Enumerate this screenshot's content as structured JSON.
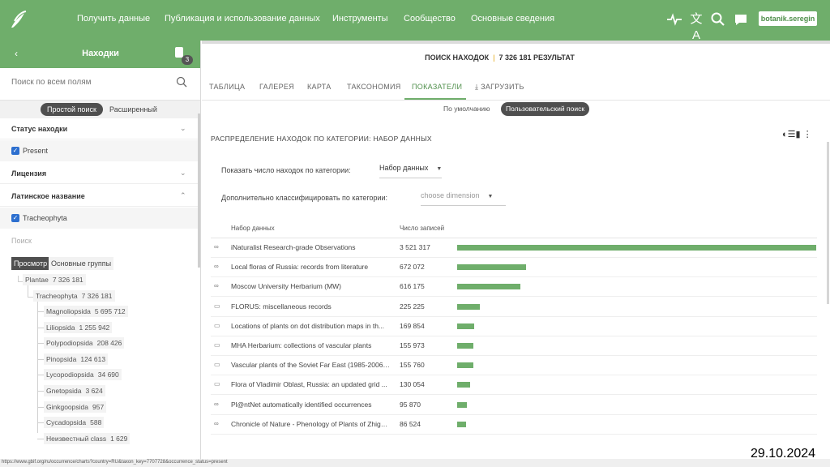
{
  "header": {
    "nav": [
      "Получить данные",
      "Публикация и использование данных",
      "Инструменты",
      "Сообщество",
      "Основные сведения"
    ],
    "user": "botanik.seregin"
  },
  "sidebar": {
    "back": "‹",
    "title": "Находки",
    "badge": "3",
    "search_placeholder": "Поиск по всем полям",
    "mode_simple": "Простой поиск",
    "mode_advanced": "Расширенный",
    "filters": {
      "status_label": "Статус находки",
      "status_value": "Present",
      "license_label": "Лицензия",
      "latin_label": "Латинское название",
      "latin_value": "Tracheophyta",
      "search_label": "Поиск"
    },
    "tree_tabs": {
      "view": "Просмотр",
      "groups": "Основные группы"
    },
    "tree": {
      "plantae": {
        "name": "Plantae",
        "count": "7 326 181"
      },
      "tracheophyta": {
        "name": "Tracheophyta",
        "count": "7 326 181"
      },
      "classes": [
        {
          "name": "Magnoliopsida",
          "count": "5 695 712"
        },
        {
          "name": "Liliopsida",
          "count": "1 255 942"
        },
        {
          "name": "Polypodiopsida",
          "count": "208 426"
        },
        {
          "name": "Pinopsida",
          "count": "124 613"
        },
        {
          "name": "Lycopodiopsida",
          "count": "34 690"
        },
        {
          "name": "Gnetopsida",
          "count": "3 624"
        },
        {
          "name": "Ginkgoopsida",
          "count": "957"
        },
        {
          "name": "Cycadopsida",
          "count": "588"
        },
        {
          "name": "Неизвестный class",
          "count": "1 629"
        }
      ]
    }
  },
  "main": {
    "results_label": "ПОИСК НАХОДОК",
    "results_count": "7 326 181 РЕЗУЛЬТАТ",
    "tabs": [
      "ТАБЛИЦА",
      "ГАЛЕРЕЯ",
      "КАРТА",
      "ТАКСОНОМИЯ",
      "ПОКАЗАТЕЛИ",
      "ЗАГРУЗИТЬ"
    ],
    "active_tab": "ПОКАЗАТЕЛИ",
    "sub_default": "По умолчанию",
    "sub_custom": "Пользовательский поиск",
    "card_title": "РАСПРЕДЕЛЕНИЕ НАХОДОК ПО КАТЕГОРИИ: НАБОР ДАННЫХ",
    "show_label": "Показать число находок по категории:",
    "show_value": "Набор данных",
    "extra_label": "Дополнительно классифицировать по категории:",
    "extra_placeholder": "choose dimension",
    "col_dataset": "Набор данных",
    "col_count": "Число записей"
  },
  "chart_data": {
    "type": "bar",
    "categories": [
      "iNaturalist Research-grade Observations",
      "Local floras of Russia: records from literature",
      "Moscow University Herbarium (MW)",
      "FLORUS: miscellaneous records",
      "Locations of plants on dot distribution maps in th...",
      "MHA Herbarium: collections of vascular plants",
      "Vascular plants of the Soviet Far East (1985-2006)...",
      "Flora of Vladimir Oblast, Russia: an updated grid ...",
      "Pl@ntNet automatically identified occurrences",
      "Chronicle of Nature - Phenology of Plants of Zhigu..."
    ],
    "values": [
      3521317,
      672072,
      616175,
      225225,
      169854,
      155973,
      155760,
      130054,
      95870,
      86524
    ],
    "labels": [
      "3 521 317",
      "672 072",
      "616 175",
      "225 225",
      "169 854",
      "155 973",
      "155 760",
      "130 054",
      "95 870",
      "86 524"
    ],
    "bar_color": "#6fae6b"
  },
  "status_url": "https://www.gbif.org/ru/occurrence/charts?country=RU&taxon_key=7707728&occurrence_status=present",
  "date": "29.10.2024"
}
